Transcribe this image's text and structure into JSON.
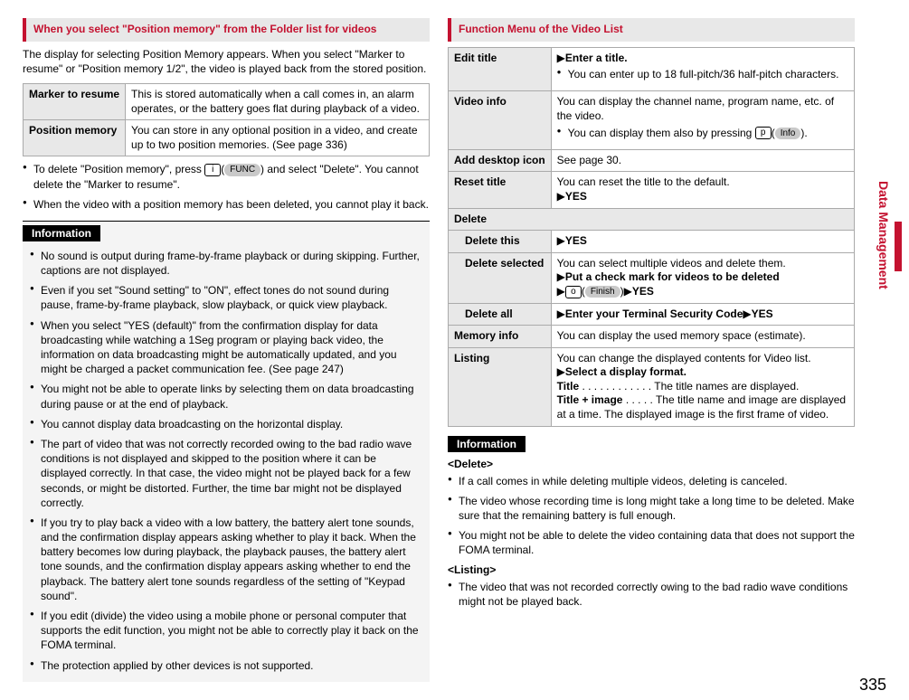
{
  "page_number": "335",
  "side_tab": "Data Management",
  "left": {
    "header": "When you select \"Position memory\" from the Folder list for videos",
    "intro": "The display for selecting Position Memory appears. When you select \"Marker to resume\" or \"Position memory 1/2\", the video is played back from the stored position.",
    "table": {
      "r1_label": "Marker to resume",
      "r1_desc": "This is stored automatically when a call comes in, an alarm operates, or the battery goes flat during playback of a video.",
      "r2_label": "Position memory",
      "r2_desc": "You can store in any optional position in a video, and create up to two position memories. (See page 336)"
    },
    "notes": {
      "n1a": "To delete \"Position memory\", press ",
      "n1_key": "i",
      "n1_soft": "FUNC",
      "n1b": " and select \"Delete\". You cannot delete the \"Marker to resume\".",
      "n2": "When the video with a position memory has been deleted, you cannot play it back."
    },
    "info_label": "Information",
    "info": {
      "i1": "No sound is output during frame-by-frame playback or during skipping. Further, captions are not displayed.",
      "i2": "Even if you set \"Sound setting\" to \"ON\", effect tones do not sound during pause, frame-by-frame playback, slow playback, or quick view playback.",
      "i3": "When you select \"YES (default)\" from the confirmation display for data broadcasting while watching a 1Seg program or playing back video, the information on data broadcasting might be automatically updated, and you might be charged a packet communication fee. (See page 247)",
      "i4": "You might not be able to operate links by selecting them on data broadcasting during pause or at the end of playback.",
      "i5": "You cannot display data broadcasting on the horizontal display.",
      "i6": "The part of video that was not correctly recorded owing to the bad radio wave conditions is not displayed and skipped to the position where it can be displayed correctly. In that case, the video might not be played back for a few seconds, or might be distorted. Further, the time bar might not be displayed correctly.",
      "i7": "If you try to play back a video with a low battery, the battery alert tone sounds, and the confirmation display appears asking whether to play it back. When the battery becomes low during playback, the playback pauses, the battery alert tone sounds, and the confirmation display appears asking whether to end the playback. The battery alert tone sounds regardless of the setting of \"Keypad sound\".",
      "i8": "If you edit (divide) the video using a mobile phone or personal computer that supports the edit function, you might not be able to correctly play it back on the FOMA terminal.",
      "i9": "The protection applied by other devices is not supported."
    }
  },
  "right": {
    "header": "Function Menu of the Video List",
    "table": {
      "edit_label": "Edit title",
      "edit_step": "Enter a title.",
      "edit_note": "You can enter up to 18 full-pitch/36 half-pitch characters.",
      "vinfo_label": "Video info",
      "vinfo_desc": "You can display the channel name, program name, etc. of the video.",
      "vinfo_note_a": "You can display them also by pressing ",
      "vinfo_key": "p",
      "vinfo_soft": "Info",
      "vinfo_note_b": ".",
      "desktop_label": "Add desktop icon",
      "desktop_desc": "See page 30.",
      "reset_label": "Reset title",
      "reset_desc": "You can reset the title to the default.",
      "reset_yes": "YES",
      "delete_label": "Delete",
      "del_this_label": "Delete this",
      "del_this_yes": "YES",
      "del_sel_label": "Delete selected",
      "del_sel_desc": "You can select multiple videos and delete them.",
      "del_sel_step": "Put a check mark for videos to be deleted",
      "del_sel_key": "o",
      "del_sel_soft": "Finish",
      "del_sel_yes": "YES",
      "del_all_label": "Delete all",
      "del_all_step": "Enter your Terminal Security Code",
      "del_all_yes": "YES",
      "mem_label": "Memory info",
      "mem_desc": "You can display the used memory space (estimate).",
      "list_label": "Listing",
      "list_desc": "You can change the displayed contents for Video list.",
      "list_step": "Select a display format.",
      "list_title_label": "Title",
      "list_title_desc": " . . . . . . . . . . . . The title names are displayed.",
      "list_ti_label": "Title + image",
      "list_ti_desc": " . . . . . The title name and image are displayed at a time. The displayed image is the first frame of video."
    },
    "info_label": "Information",
    "info_delete_head": "<Delete>",
    "info": {
      "d1": "If a call comes in while deleting multiple videos, deleting is canceled.",
      "d2": "The video whose recording time is long might take a long time to be deleted. Make sure that the remaining battery is full enough.",
      "d3": "You might not be able to delete the video containing data that does not support the FOMA terminal."
    },
    "info_listing_head": "<Listing>",
    "info_listing": {
      "l1": "The video that was not recorded correctly owing to the bad radio wave conditions might not be played back."
    }
  }
}
